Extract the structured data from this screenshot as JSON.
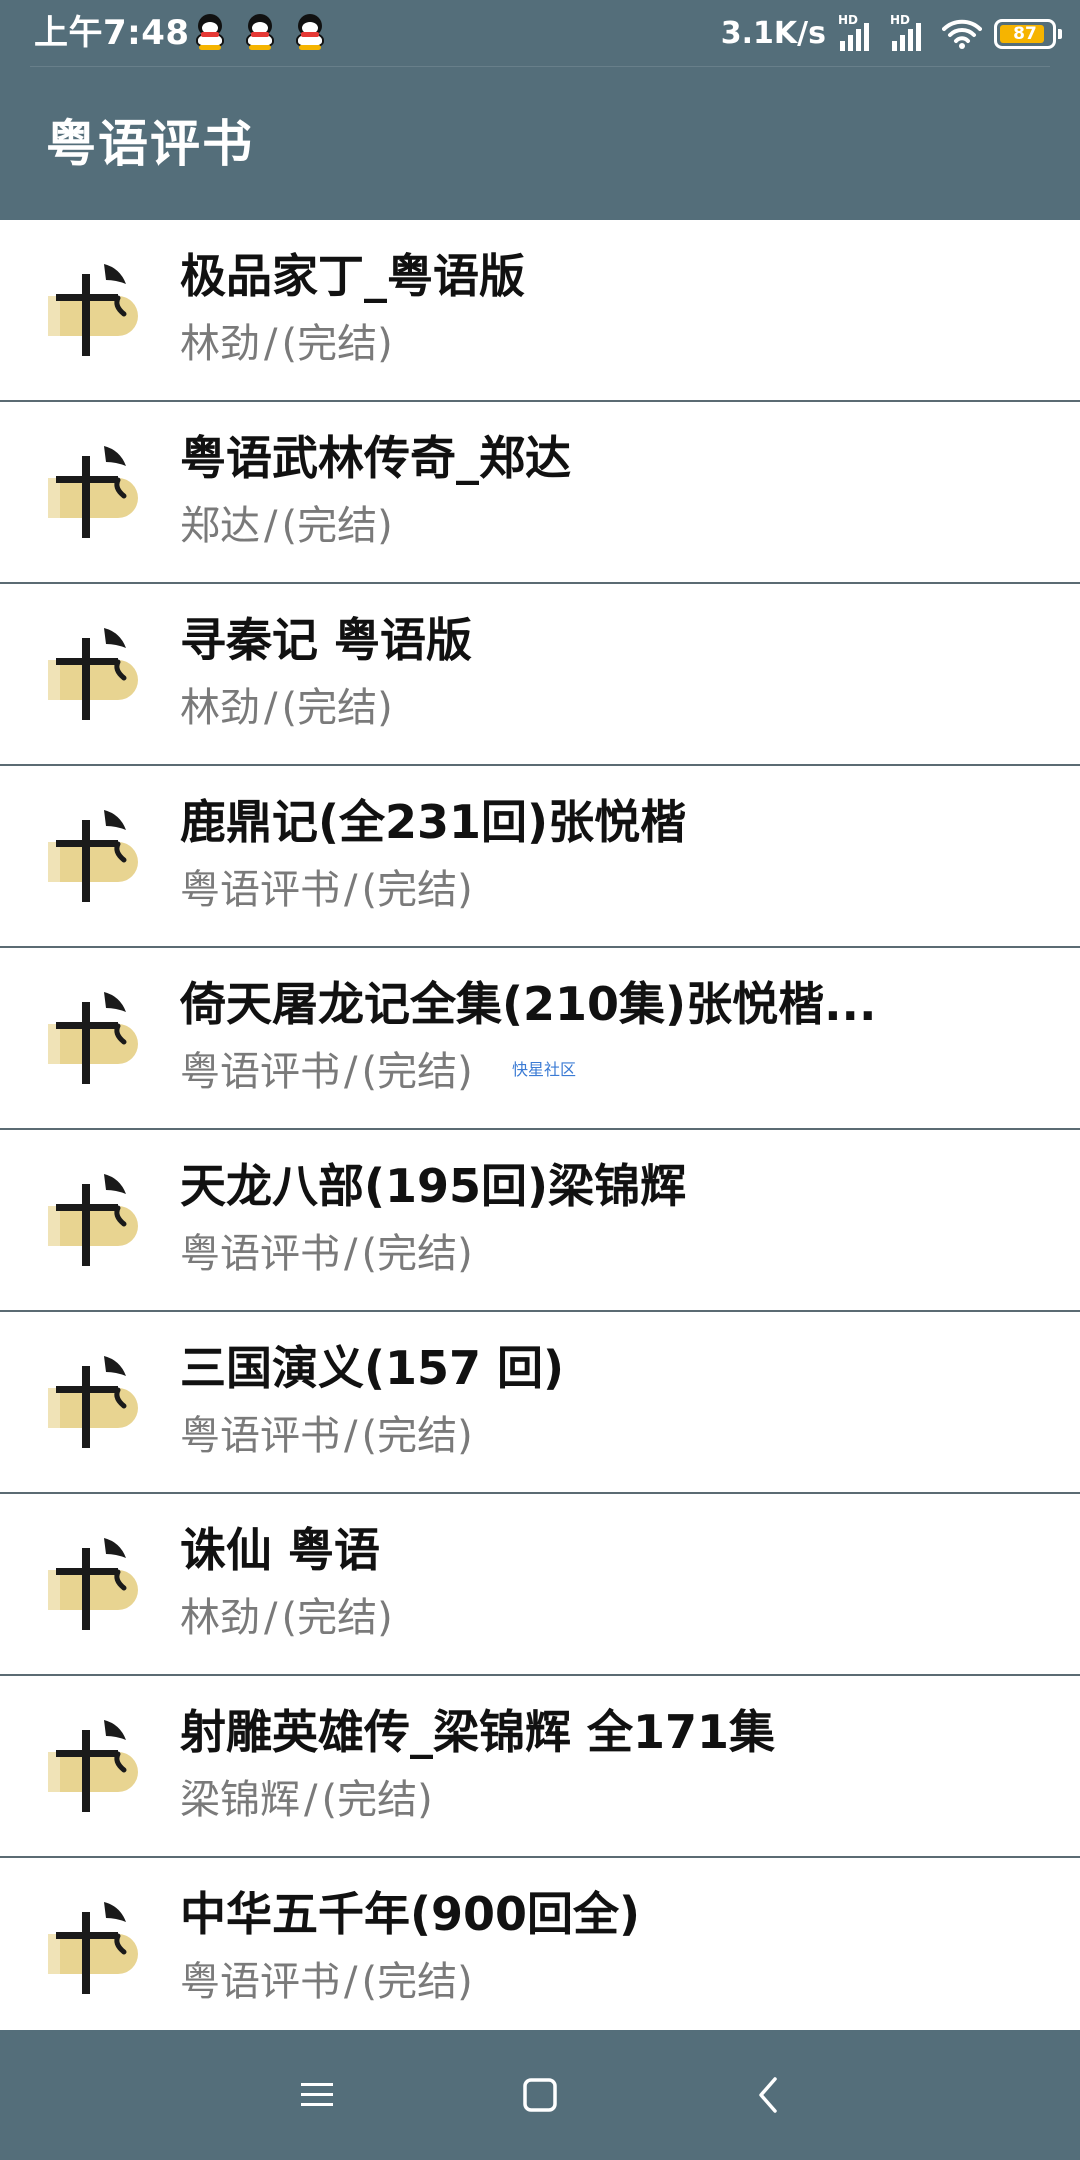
{
  "status_bar": {
    "time": "上午7:48",
    "net_speed": "3.1K/s",
    "signal_label_1": "HD",
    "signal_label_2": "HD",
    "battery": "87",
    "battery_level": 0.87
  },
  "app_bar": {
    "title": "粤语评书"
  },
  "list": [
    {
      "title": "极品家丁_粤语版",
      "author": "林劲",
      "status": "(完结)"
    },
    {
      "title": "粤语武林传奇_郑达",
      "author": "郑达",
      "status": "(完结)"
    },
    {
      "title": "寻秦记 粤语版",
      "author": "林劲",
      "status": "(完结)"
    },
    {
      "title": "鹿鼎记(全231回)张悦楷",
      "author": "粤语评书",
      "status": "(完结)"
    },
    {
      "title": "倚天屠龙记全集(210集)张悦楷...",
      "author": "粤语评书",
      "status": "(完结)"
    },
    {
      "title": "天龙八部(195回)梁锦辉",
      "author": "粤语评书",
      "status": "(完结)"
    },
    {
      "title": "三国演义(157 回)",
      "author": "粤语评书",
      "status": "(完结)"
    },
    {
      "title": "诛仙 粤语",
      "author": "林劲",
      "status": "(完结)"
    },
    {
      "title": "射雕英雄传_梁锦辉 全171集",
      "author": "梁锦辉",
      "status": "(完结)"
    },
    {
      "title": "中华五千年(900回全)",
      "author": "粤语评书",
      "status": "(完结)"
    }
  ],
  "separator": "/",
  "watermark": "快星社区",
  "icons": {
    "book": "book-cover-icon",
    "menu": "menu-icon",
    "home": "home-icon",
    "back": "back-icon"
  },
  "colors": {
    "bar": "#546e7a",
    "book_accent": "#e8d491",
    "title": "#111111",
    "subtitle": "#7a7a7a"
  }
}
